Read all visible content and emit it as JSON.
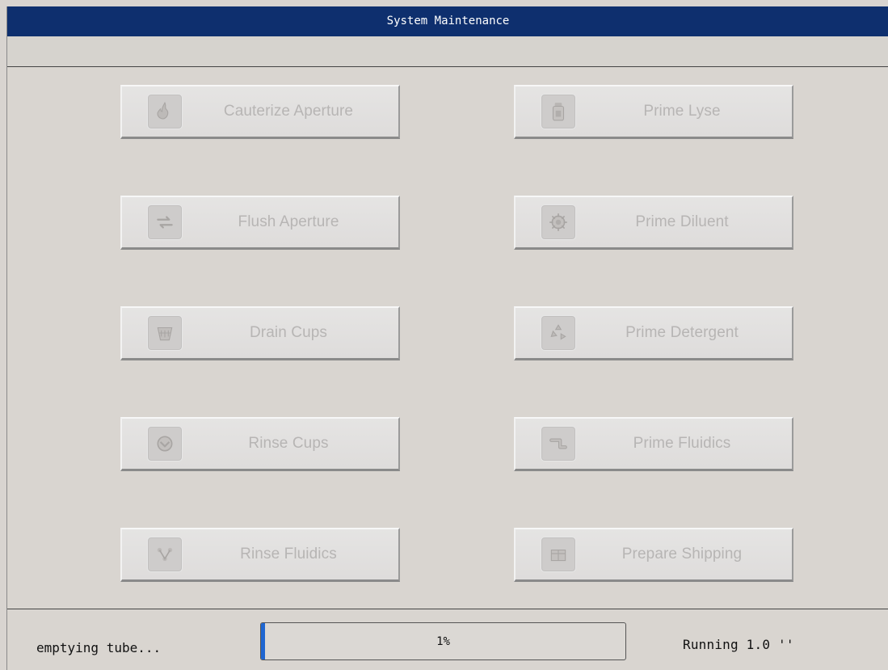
{
  "window": {
    "title": "System Maintenance"
  },
  "buttons": [
    {
      "label": "Cauterize Aperture",
      "icon": "flame-icon"
    },
    {
      "label": "Prime Lyse",
      "icon": "bottle-icon"
    },
    {
      "label": "Flush Aperture",
      "icon": "swap-arrows-icon"
    },
    {
      "label": "Prime Diluent",
      "icon": "gear-icon"
    },
    {
      "label": "Drain Cups",
      "icon": "drain-icon"
    },
    {
      "label": "Prime Detergent",
      "icon": "recycle-icon"
    },
    {
      "label": "Rinse Cups",
      "icon": "rinse-icon"
    },
    {
      "label": "Prime Fluidics",
      "icon": "pipe-icon"
    },
    {
      "label": "Rinse Fluidics",
      "icon": "flow-icon"
    },
    {
      "label": "Prepare Shipping",
      "icon": "package-icon"
    }
  ],
  "status": {
    "message": "emptying tube...",
    "progress_percent": 1,
    "progress_label": "1%",
    "running_text": "Running 1.0 ''"
  },
  "colors": {
    "titlebar": "#0e2f6e",
    "progress_fill": "#1f66d1",
    "button_text_disabled": "#b7b5b4"
  }
}
